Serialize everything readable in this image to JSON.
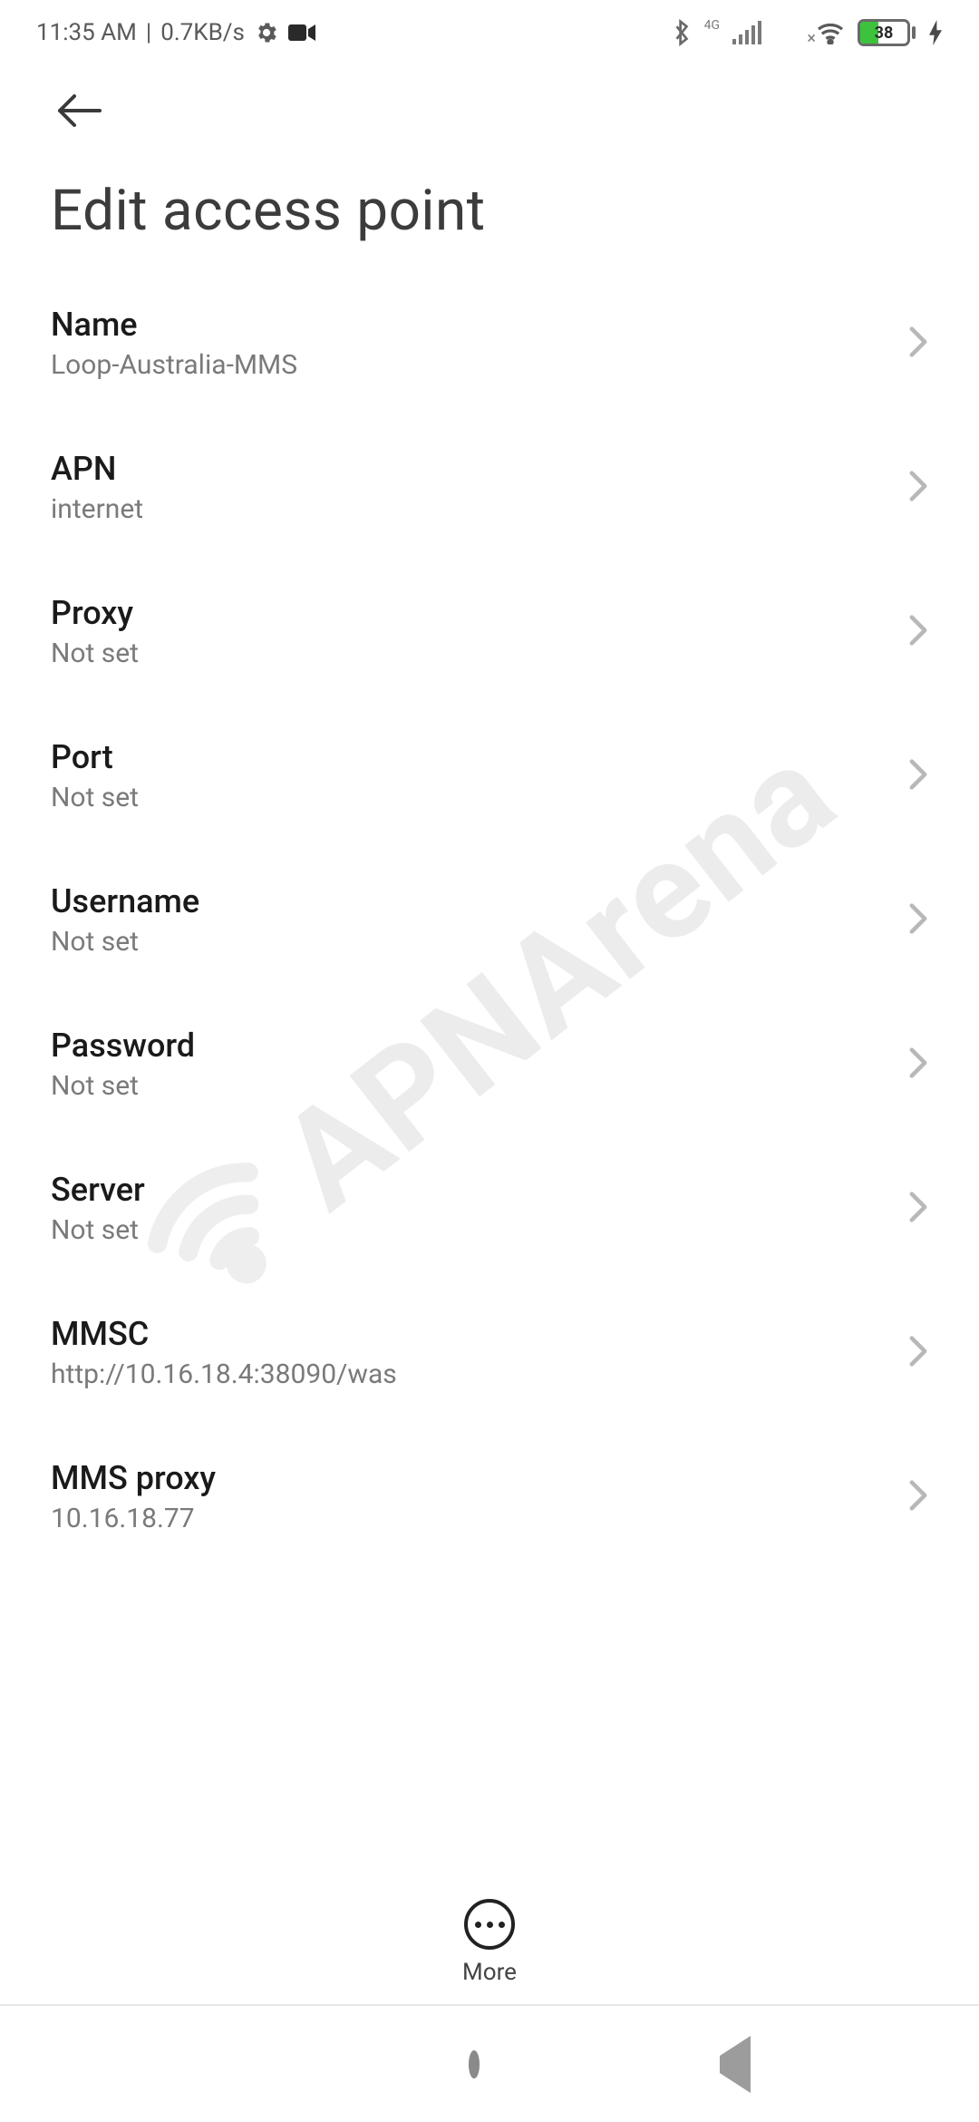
{
  "status_bar": {
    "time": "11:35 AM",
    "data_rate": "0.7KB/s",
    "network_label": "4G",
    "battery_percent": "38"
  },
  "page_title": "Edit access point",
  "settings": [
    {
      "key": "name",
      "label": "Name",
      "value": "Loop-Australia-MMS"
    },
    {
      "key": "apn",
      "label": "APN",
      "value": "internet"
    },
    {
      "key": "proxy",
      "label": "Proxy",
      "value": "Not set"
    },
    {
      "key": "port",
      "label": "Port",
      "value": "Not set"
    },
    {
      "key": "username",
      "label": "Username",
      "value": "Not set"
    },
    {
      "key": "password",
      "label": "Password",
      "value": "Not set"
    },
    {
      "key": "server",
      "label": "Server",
      "value": "Not set"
    },
    {
      "key": "mmsc",
      "label": "MMSC",
      "value": "http://10.16.18.4:38090/was"
    },
    {
      "key": "mms_proxy",
      "label": "MMS proxy",
      "value": "10.16.18.77"
    }
  ],
  "more_button_label": "More",
  "watermark_text": "APNArena"
}
